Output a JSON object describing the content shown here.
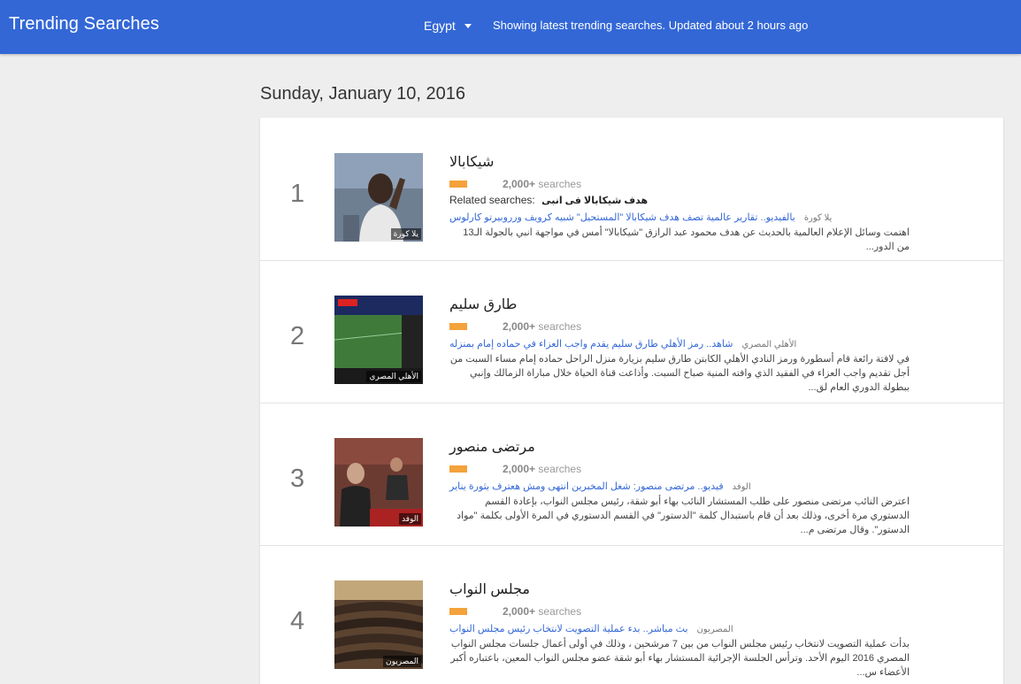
{
  "header": {
    "title": "Trending Searches",
    "country": "Egypt",
    "status": "Showing latest trending searches. Updated about 2 hours ago"
  },
  "date": "Sunday, January 10, 2016",
  "colors": {
    "brand": "#3367d6",
    "volume_bar": "#f4a23b"
  },
  "items": [
    {
      "rank": "1",
      "query": "شيكابالا",
      "volume": "2,000+",
      "volume_suffix": "searches",
      "related_label": "Related searches:",
      "related": "هدف شيكابالا فى انبى",
      "article_source": "يلا كورة",
      "article_title": "بالفيديو.. تقارير عالمية تصف هدف شيكابالا \"المستحيل\" شبيه كرويف ورروبيرتو كارلوس",
      "snippet": "اهتمت وسائل الإعلام العالمية بالحديث عن هدف محمود عبد الرازق \"شيكابالا\" أمس في مواجهة انبي بالجولة الـ13 من الدور...",
      "thumb_tag": "يلا كورة"
    },
    {
      "rank": "2",
      "query": "طارق سليم",
      "volume": "2,000+",
      "volume_suffix": "searches",
      "article_source": "الأهلي المصري",
      "article_title": "شاهد.. رمز الأهلي طارق سليم يقدم واجب العزاء في حماده إمام بمنزله",
      "snippet": "في لافتة رائعة قام أسطورة ورمز النادي الأهلي الكابتن طارق سليم بزيارة منزل الراحل حماده إمام مساء السبت من أجل تقديم واجب العزاء في الفقيد الذي وافته المنية صباح السبت. وأذاعت قناة الحياة خلال مباراة الزمالك وإنبي ببطولة الدوري العام لق...",
      "thumb_tag": "الأهلي المصري"
    },
    {
      "rank": "3",
      "query": "مرتضى منصور",
      "volume": "2,000+",
      "volume_suffix": "searches",
      "article_source": "الوفد",
      "article_title": "فيديو.. مرتضى منصور: شغل المخبرين انتهى ومش هعترف بثورة يناير",
      "snippet": "اعترض النائب مرتضى منصور على طلب المستشار النائب بهاء أبو شقة، رئيس مجلس النواب، بإعادة القسم الدستوري مرة أخرى، وذلك بعد أن قام باستبدال كلمة \"الدستور\" في القسم الدستوري في المرة الأولى بكلمة \"مواد الدستور\". وقال مرتضى م...",
      "thumb_tag": "الوفد"
    },
    {
      "rank": "4",
      "query": "مجلس النواب",
      "volume": "2,000+",
      "volume_suffix": "searches",
      "article_source": "المصريون",
      "article_title": "بث مباشر.. بدء عملية التصويت لانتخاب رئيس مجلس النواب",
      "snippet": "بدأت عملية التصويت لانتخاب رئيس مجلس النواب من بين 7 مرشحين ، وذلك في أولى أعمال جلسات مجلس النواب المصري 2016 اليوم الأحد. وترأس الجلسة الإجرائية المستشار بهاء أبو شقة عضو مجلس النواب المعين، باعتباره أكبر الأعضاء س...",
      "thumb_tag": "المصريون"
    }
  ]
}
